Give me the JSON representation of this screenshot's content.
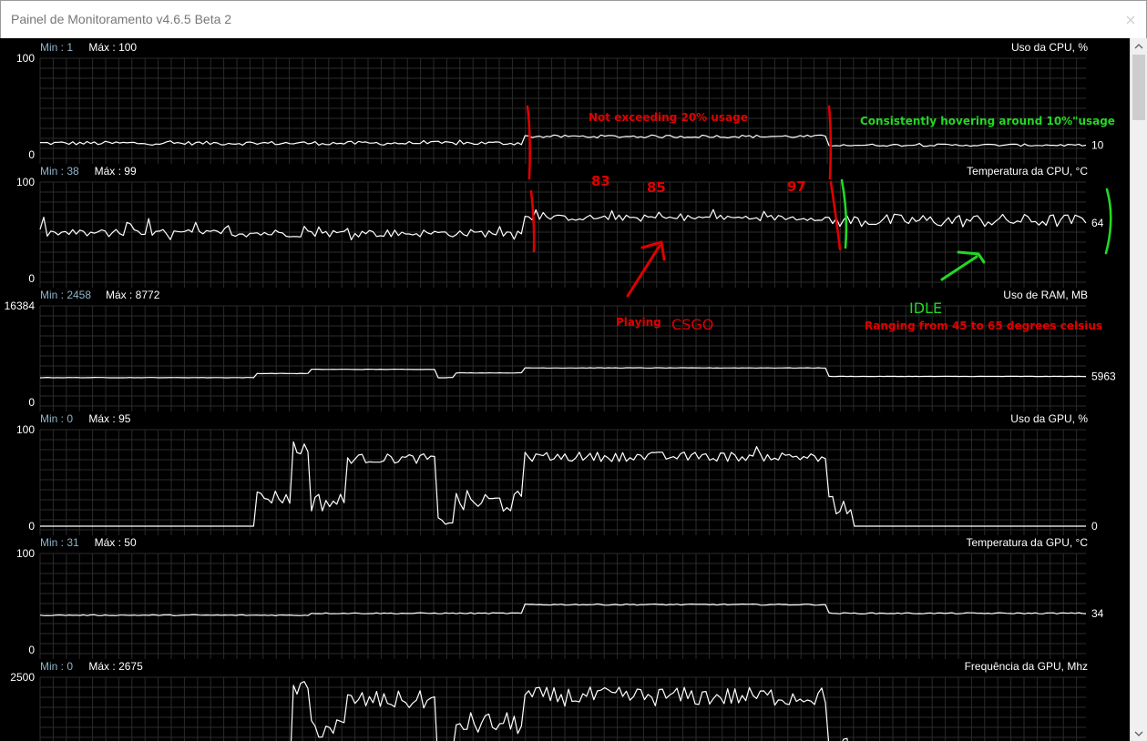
{
  "window": {
    "title": "Painel de Monitoramento v4.6.5 Beta 2",
    "close_glyph": "✕"
  },
  "panels": [
    {
      "id": "cpu-usage",
      "min_label": "Min : 1",
      "max_label": "Máx : 100",
      "title": "Uso da CPU, %",
      "y_top": "100",
      "y_bottom": "0",
      "current": "10",
      "ymax": 100
    },
    {
      "id": "cpu-temp",
      "min_label": "Min : 38",
      "max_label": "Máx : 99",
      "title": "Temperatura da CPU, °C",
      "y_top": "100",
      "y_bottom": "0",
      "current": "64",
      "ymax": 100
    },
    {
      "id": "ram-usage",
      "min_label": "Min : 2458",
      "max_label": "Máx : 8772",
      "title": "Uso de RAM, MB",
      "y_top": "16384",
      "y_bottom": "0",
      "current": "5963",
      "ymax": 16384
    },
    {
      "id": "gpu-usage",
      "min_label": "Min : 0",
      "max_label": "Máx : 95",
      "title": "Uso da GPU, %",
      "y_top": "100",
      "y_bottom": "0",
      "current": "0",
      "ymax": 100
    },
    {
      "id": "gpu-temp",
      "min_label": "Min : 31",
      "max_label": "Máx : 50",
      "title": "Temperatura da GPU, °C",
      "y_top": "100",
      "y_bottom": "0",
      "current": "34",
      "ymax": 100
    },
    {
      "id": "gpu-clock",
      "min_label": "Min : 0",
      "max_label": "Máx : 2675",
      "title": "Frequência da GPU, Mhz",
      "y_top": "2500",
      "y_bottom": "",
      "current": "",
      "ymax": 2500
    }
  ],
  "annotations": {
    "cpu_usage_playing": "Not exceeding 20% usage",
    "cpu_usage_idle": "Consistently hovering around 10%\"usage",
    "temp_peak_1": "83",
    "temp_peak_2": "85",
    "temp_peak_3": "97",
    "playing_label": "Playing",
    "csgo_label": "CSGO",
    "idle_label": "IDLE",
    "idle_range": "Ranging from 45 to 65 degrees celsius"
  },
  "colors": {
    "background": "#000000",
    "grid": "#2b2b2b",
    "trace": "#ffffff",
    "min_value": "#8fb4c8",
    "label": "#ffffff",
    "annotation_red": "#e00000",
    "annotation_green": "#22d822"
  },
  "icons": {
    "close": "close-icon",
    "scroll_up": "scroll-up-arrow-icon",
    "scroll_down": "scroll-down-arrow-icon"
  }
}
